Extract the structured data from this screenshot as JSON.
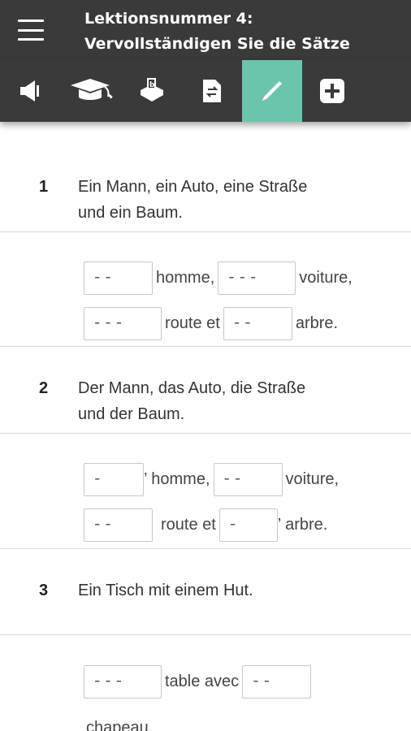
{
  "header": {
    "title_line1": "Lektionsnummer 4:",
    "title_line2": "Vervollständigen Sie die Sätze"
  },
  "toolbar": {
    "items": [
      {
        "icon": "speaker-icon",
        "active": false
      },
      {
        "icon": "graduation-cap-icon",
        "active": false
      },
      {
        "icon": "ballot-box-icon",
        "active": false
      },
      {
        "icon": "document-swap-icon",
        "active": false
      },
      {
        "icon": "pencil-icon",
        "active": true
      },
      {
        "icon": "plus-square-icon",
        "active": false
      }
    ],
    "accent_color": "#6cc4ad"
  },
  "exercises": [
    {
      "number": "1",
      "prompt_line1": "Ein Mann, ein Auto, eine Straße",
      "prompt_line2": "und ein Baum.",
      "line1": {
        "blank1": "--",
        "word1": "homme,",
        "blank2": "---",
        "word2": "voiture,"
      },
      "line2": {
        "blank1": "---",
        "word1": "route et",
        "blank2": "--",
        "word2": "arbre."
      }
    },
    {
      "number": "2",
      "prompt_line1": "Der Mann, das Auto, die Straße",
      "prompt_line2": "und der Baum.",
      "line1": {
        "blank1": "-",
        "word1": "’ homme,",
        "blank2": "--",
        "word2": "voiture,"
      },
      "line2": {
        "blank1": "--",
        "word1": "route et",
        "blank2": "-",
        "word2": "’ arbre."
      }
    },
    {
      "number": "3",
      "prompt_line1": "Ein Tisch mit einem Hut.",
      "line1": {
        "blank1": "---",
        "word1": "table avec",
        "blank2": "--"
      },
      "line2": {
        "word1": "chapeau."
      }
    }
  ]
}
